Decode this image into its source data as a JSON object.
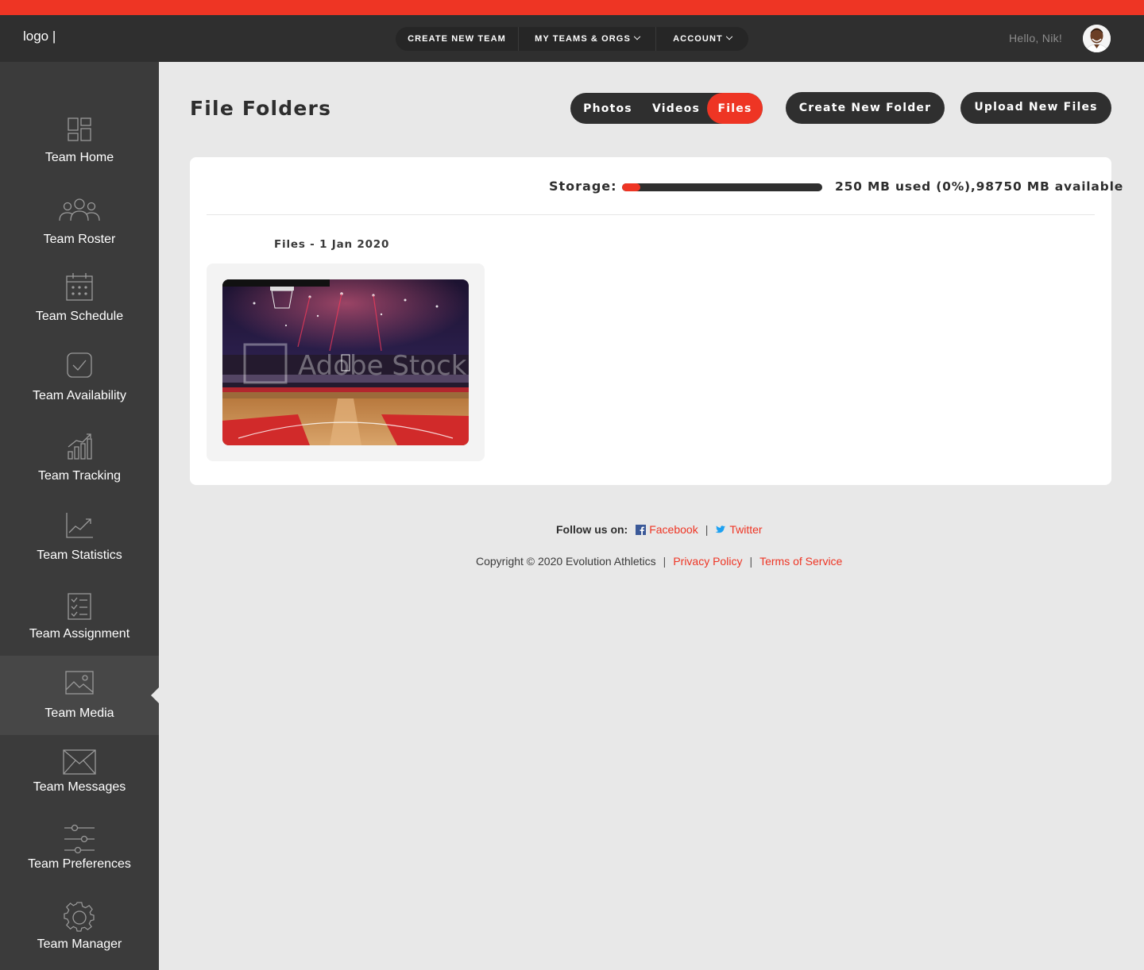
{
  "header": {
    "logo": "logo |",
    "nav": [
      {
        "label": "CREATE NEW TEAM",
        "has_dropdown": false
      },
      {
        "label": "MY TEAMS & ORGS",
        "has_dropdown": true
      },
      {
        "label": "ACCOUNT",
        "has_dropdown": true
      }
    ],
    "greeting": "Hello, Nik!"
  },
  "sidebar": {
    "items": [
      {
        "label": "Team Home",
        "icon": "dashboard-icon"
      },
      {
        "label": "Team Roster",
        "icon": "people-icon"
      },
      {
        "label": "Team Schedule",
        "icon": "calendar-icon"
      },
      {
        "label": "Team Availability",
        "icon": "checkbox-icon"
      },
      {
        "label": "Team Tracking",
        "icon": "bar-chart-icon"
      },
      {
        "label": "Team Statistics",
        "icon": "trend-line-icon"
      },
      {
        "label": "Team Assignment",
        "icon": "checklist-icon"
      },
      {
        "label": "Team Media",
        "icon": "image-icon",
        "active": true
      },
      {
        "label": "Team Messages",
        "icon": "envelope-icon"
      },
      {
        "label": "Team Preferences",
        "icon": "sliders-icon"
      },
      {
        "label": "Team Manager",
        "icon": "gear-icon"
      }
    ]
  },
  "main": {
    "title": "File Folders",
    "media_tabs": [
      {
        "label": "Photos",
        "active": false
      },
      {
        "label": "Videos",
        "active": false
      },
      {
        "label": "Files",
        "active": true
      }
    ],
    "create_folder_label": "Create New Folder",
    "upload_label": "Upload New Files",
    "storage": {
      "label": "Storage:",
      "used_fraction": 0.0025,
      "text": "250 MB used (0%),98750 MB available"
    },
    "folders": [
      {
        "title": "Files - 1 Jan 2020",
        "thumbnail": "basketball arena"
      }
    ]
  },
  "footer": {
    "follow_label": "Follow us on:",
    "facebook": "Facebook",
    "twitter": "Twitter",
    "copyright": "Copyright © 2020 Evolution Athletics",
    "privacy": "Privacy Policy",
    "terms": "Terms of Service"
  },
  "colors": {
    "accent": "#ee3524",
    "dark": "#2f2f2f",
    "sidebar": "#3b3b3b",
    "background": "#e8e8e8"
  }
}
